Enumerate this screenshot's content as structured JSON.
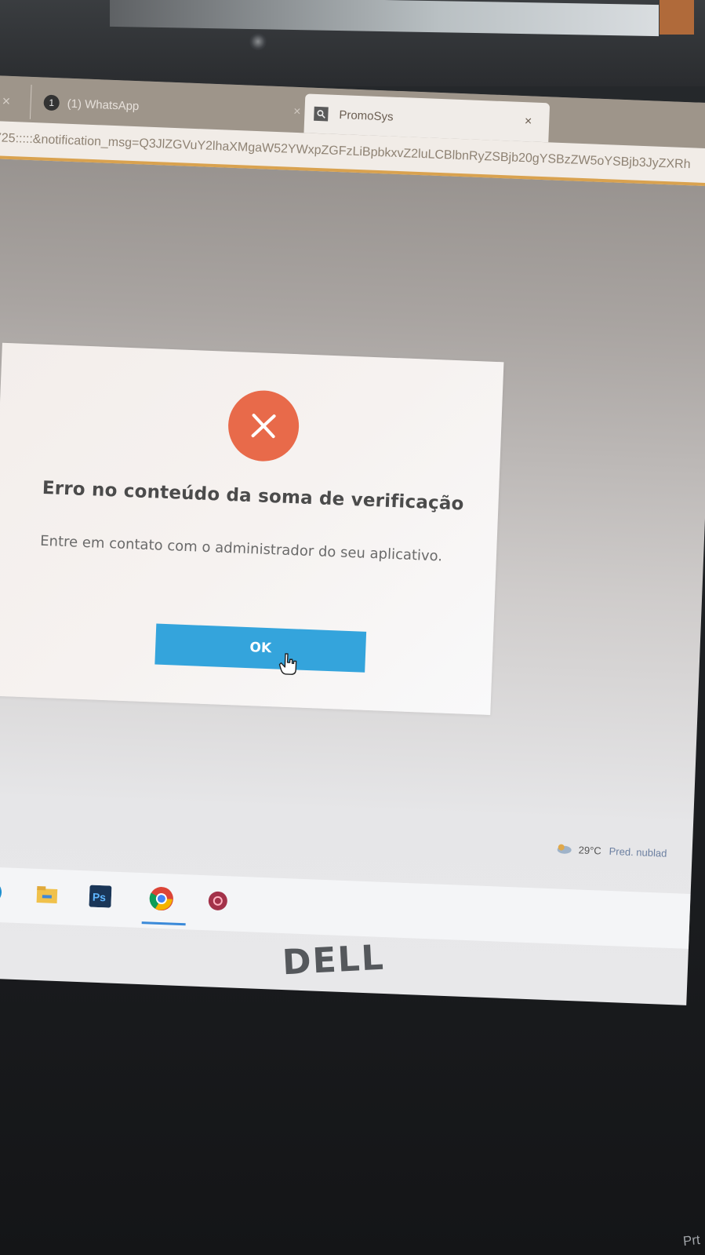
{
  "browser": {
    "tabs": [
      {
        "label": "(1) WhatsApp",
        "badge": "1"
      },
      {
        "label": "PromoSys"
      }
    ],
    "close_glyph": "×",
    "address_url": "725:::::&notification_msg=Q3JlZGVuY2lhaXMgaW52YWxpZGFzLiBpbkxvZ2luLCBlbnRyZSBjb20gYSBzZW5oYSBjb3JyZXRh"
  },
  "dialog": {
    "icon": "error-x-icon",
    "title": "Erro no conteúdo da soma de verificação",
    "message": "Entre em contato com o administrador do seu aplicativo.",
    "ok_label": "OK",
    "colors": {
      "icon_bg": "#e86a4a",
      "button_bg": "#34a4dc"
    }
  },
  "taskbar": {
    "weather_temp": "29°C",
    "weather_desc": "Pred. nublad",
    "icons": [
      "edge-icon",
      "file-explorer-icon",
      "photoshop-icon",
      "chrome-icon",
      "app-icon"
    ],
    "photoshop_label": "Ps"
  },
  "bezel": {
    "brand": "DELL",
    "corner_text": "Prt"
  }
}
